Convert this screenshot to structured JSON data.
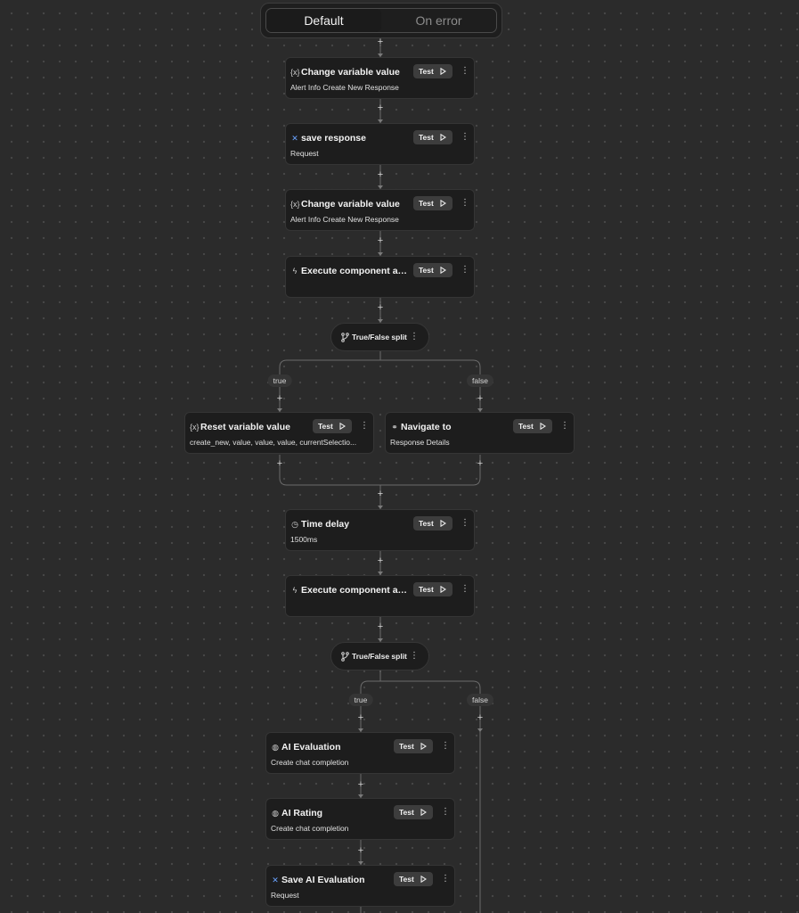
{
  "tabs": {
    "default_label": "Default",
    "on_error_label": "On error",
    "active": "default"
  },
  "test_label": "Test",
  "nodes": {
    "change_var_1": {
      "icon": "variable-icon",
      "title": "Change variable value",
      "subtitle": "Alert Info Create New Response"
    },
    "save_response": {
      "icon": "integration-x-icon",
      "title": "save response",
      "subtitle": "Request"
    },
    "change_var_2": {
      "icon": "variable-icon",
      "title": "Change variable value",
      "subtitle": "Alert Info Create New Response"
    },
    "exec_action_1": {
      "icon": "lightning-icon",
      "title": "Execute component act...",
      "subtitle": ""
    },
    "reset_var": {
      "icon": "variable-icon",
      "title": "Reset variable value",
      "subtitle": "create_new, value, value, value, currentSelectio..."
    },
    "navigate": {
      "icon": "link-icon",
      "title": "Navigate to",
      "subtitle": "Response Details"
    },
    "time_delay": {
      "icon": "clock-icon",
      "title": "Time delay",
      "subtitle": "1500ms"
    },
    "exec_action_2": {
      "icon": "lightning-icon",
      "title": "Execute component act...",
      "subtitle": ""
    },
    "ai_evaluation": {
      "icon": "ai-model-icon",
      "title": "AI Evaluation",
      "subtitle": "Create chat completion"
    },
    "ai_rating": {
      "icon": "ai-model-icon",
      "title": "AI Rating",
      "subtitle": "Create chat completion"
    },
    "save_ai_eval": {
      "icon": "integration-x-icon",
      "title": "Save AI Evaluation",
      "subtitle": "Request"
    }
  },
  "splits": {
    "split_1": {
      "icon": "branch-icon",
      "label": "True/False split"
    },
    "split_2": {
      "icon": "branch-icon",
      "label": "True/False split"
    }
  },
  "branch_labels": {
    "true_label": "true",
    "false_label": "false"
  },
  "add_step_symbol": "+",
  "menu_symbol": "⋮"
}
